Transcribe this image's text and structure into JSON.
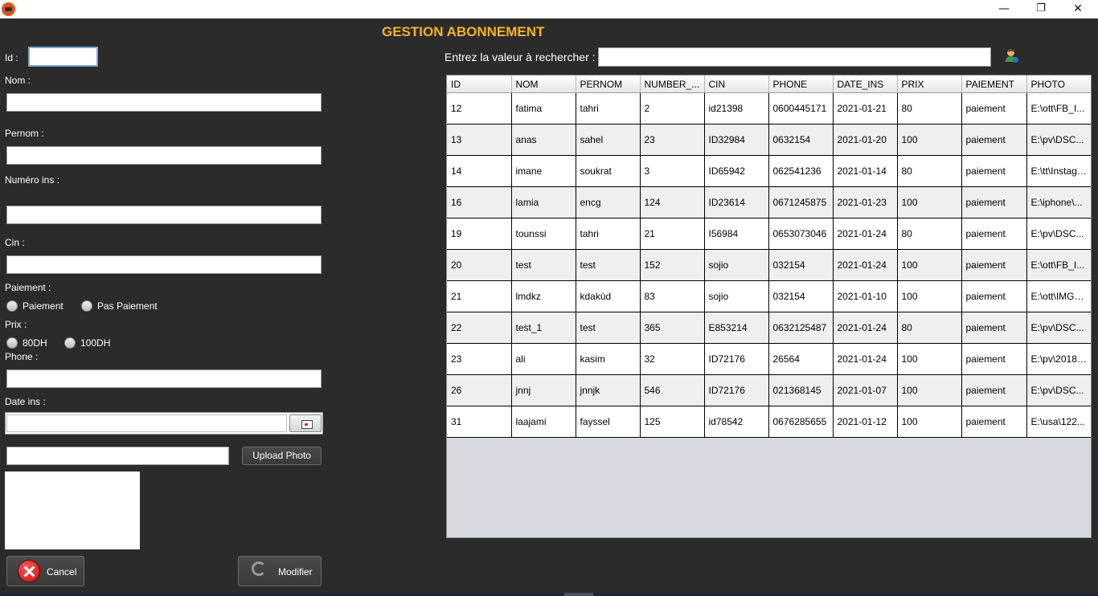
{
  "window": {
    "minimize": "—",
    "restore": "❐",
    "close": "✕"
  },
  "heading": "GESTION ABONNEMENT",
  "form": {
    "id_label": "Id :",
    "id_value": "",
    "nom_label": "Nom :",
    "nom_value": "",
    "pernom_label": "Pernom :",
    "pernom_value": "",
    "numero_label": "Numéro ins :",
    "numero_value": "",
    "cin_label": "Cin :",
    "cin_value": "",
    "paiement_label": "Paiement :",
    "paiement_options": [
      "Paiement",
      "Pas Paiement"
    ],
    "prix_label": "Prix :",
    "prix_options": [
      "80DH",
      "100DH"
    ],
    "phone_label": "Phone :",
    "phone_value": "",
    "date_label": "Date ins :",
    "date_value": "",
    "photo_path": "",
    "upload_label": "Upload Photo",
    "cancel_label": "Cancel",
    "modifier_label": "Modifier"
  },
  "search": {
    "label": "Entrez la valeur à rechercher :",
    "value": ""
  },
  "table": {
    "columns": [
      "ID",
      "NOM",
      "PERNOM",
      "NUMBER_...",
      "CIN",
      "PHONE",
      "DATE_INS",
      "PRIX",
      "PAIEMENT",
      "PHOTO"
    ],
    "rows": [
      [
        "12",
        "fatima",
        "tahri",
        "2",
        "id21398",
        "0600445171",
        "2021-01-21",
        "80",
        "paiement",
        "E:\\ott\\FB_I..."
      ],
      [
        "13",
        "anas",
        "sahel",
        "23",
        "ID32984",
        "0632154",
        "2021-01-20",
        "100",
        "paiement",
        "E:\\pv\\DSC..."
      ],
      [
        "14",
        "imane",
        "soukrat",
        "3",
        "ID65942",
        "062541236",
        "2021-01-14",
        "80",
        "paiement",
        "E:\\tt\\Instagr..."
      ],
      [
        "16",
        "lamia",
        "encg",
        "124",
        "ID23614",
        "0671245875",
        "2021-01-23",
        "100",
        "paiement",
        "E:\\iphone\\..."
      ],
      [
        "19",
        "tounssi",
        "tahri",
        "21",
        "I56984",
        "0653073046",
        "2021-01-24",
        "80",
        "paiement",
        "E:\\pv\\DSC..."
      ],
      [
        "20",
        "test",
        "test",
        "152",
        "sojio",
        "032154",
        "2021-01-24",
        "100",
        "paiement",
        "E:\\ott\\FB_I..."
      ],
      [
        "21",
        "lmdkz",
        "kdakùd",
        "83",
        "sojio",
        "032154",
        "2021-01-10",
        "100",
        "paiement",
        "E:\\ott\\IMG_..."
      ],
      [
        "22",
        "test_1",
        "test",
        "365",
        "E853214",
        "0632125487",
        "2021-01-24",
        "80",
        "paiement",
        "E:\\pv\\DSC..."
      ],
      [
        "23",
        "ali",
        "kasim",
        "32",
        "ID72176",
        "26564",
        "2021-01-24",
        "100",
        "paiement",
        "E:\\pv\\2018-..."
      ],
      [
        "26",
        "jnnj",
        "jnnjk",
        "546",
        "ID72176",
        "021368145",
        "2021-01-07",
        "100",
        "paiement",
        "E:\\pv\\DSC..."
      ],
      [
        "31",
        "laajami",
        "fayssel",
        "125",
        "id78542",
        "0676285655",
        "2021-01-12",
        "100",
        "paiement",
        "E:\\usa\\122..."
      ]
    ]
  },
  "colors": {
    "background": "#2b2b2b",
    "heading": "#f5b324"
  },
  "icons": {
    "search_user": "user-search-icon",
    "calendar": "calendar-icon",
    "cancel": "cancel-icon",
    "modifier": "refresh-icon"
  }
}
